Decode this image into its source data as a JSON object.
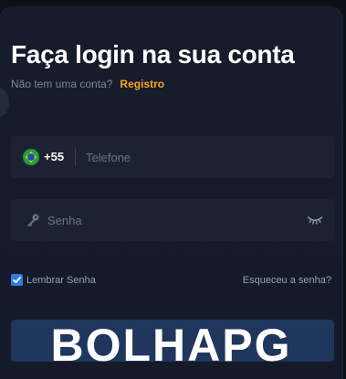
{
  "modal": {
    "title": "Faça login na sua conta",
    "subtitle_text": "Não tem uma conta?",
    "register_link": "Registro"
  },
  "phone_field": {
    "country_flag_icon": "brazil-flag-icon",
    "country_code": "+55",
    "placeholder": "Telefone",
    "value": ""
  },
  "password_field": {
    "leading_icon": "key-icon",
    "placeholder": "Senha",
    "value": "",
    "trailing_icon": "eye-closed-icon"
  },
  "options": {
    "remember_label": "Lembrar Senha",
    "remember_checked": true,
    "forgot_link": "Esqueceu a senha?"
  },
  "watermark": {
    "text": "BOLHAPG"
  },
  "colors": {
    "background": "#0d1117",
    "modal": "#161c2b",
    "field": "#1c2232",
    "accent": "#f5a623",
    "checkbox": "#2f7de0",
    "button": "#21365c"
  }
}
